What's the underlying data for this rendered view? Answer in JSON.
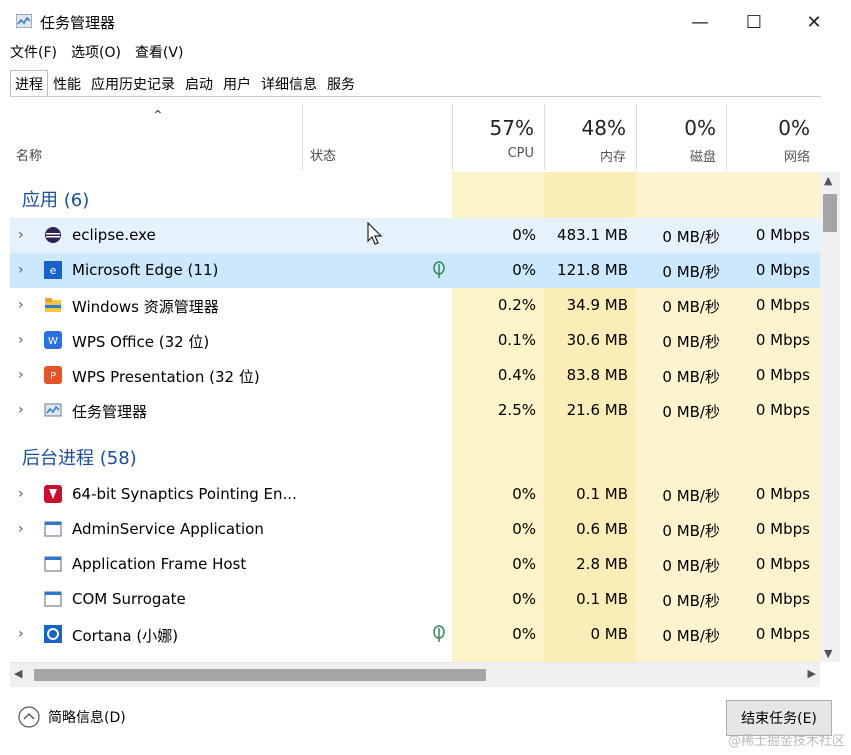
{
  "window": {
    "title": "任务管理器",
    "controls": {
      "minimize": "—",
      "maximize": "☐",
      "close": "✕"
    }
  },
  "menu": [
    "文件(F)",
    "选项(O)",
    "查看(V)"
  ],
  "tabs": [
    "进程",
    "性能",
    "应用历史记录",
    "启动",
    "用户",
    "详细信息",
    "服务"
  ],
  "columns": {
    "name": "名称",
    "status": "状态",
    "sort_indicator": "⌃",
    "cpu": {
      "pct": "57%",
      "label": "CPU"
    },
    "mem": {
      "pct": "48%",
      "label": "内存"
    },
    "disk": {
      "pct": "0%",
      "label": "磁盘"
    },
    "net": {
      "pct": "0%",
      "label": "网络"
    }
  },
  "groups": {
    "apps": "应用 (6)",
    "background": "后台进程 (58)"
  },
  "apps": [
    {
      "name": "eclipse.exe",
      "cpu": "0%",
      "mem": "483.1 MB",
      "disk": "0 MB/秒",
      "net": "0 Mbps",
      "icon": "eclipse-icon"
    },
    {
      "name": "Microsoft Edge (11)",
      "cpu": "0%",
      "mem": "121.8 MB",
      "disk": "0 MB/秒",
      "net": "0 Mbps",
      "icon": "edge-icon",
      "status": "leaf-icon"
    },
    {
      "name": "Windows 资源管理器",
      "cpu": "0.2%",
      "mem": "34.9 MB",
      "disk": "0 MB/秒",
      "net": "0 Mbps",
      "icon": "folder-icon"
    },
    {
      "name": "WPS Office (32 位)",
      "cpu": "0.1%",
      "mem": "30.6 MB",
      "disk": "0 MB/秒",
      "net": "0 Mbps",
      "icon": "wps-icon"
    },
    {
      "name": "WPS Presentation (32 位)",
      "cpu": "0.4%",
      "mem": "83.8 MB",
      "disk": "0 MB/秒",
      "net": "0 Mbps",
      "icon": "presentation-icon"
    },
    {
      "name": "任务管理器",
      "cpu": "2.5%",
      "mem": "21.6 MB",
      "disk": "0 MB/秒",
      "net": "0 Mbps",
      "icon": "taskmgr-icon"
    }
  ],
  "background": [
    {
      "name": "64-bit Synaptics Pointing En...",
      "cpu": "0%",
      "mem": "0.1 MB",
      "disk": "0 MB/秒",
      "net": "0 Mbps",
      "icon": "synaptics-icon"
    },
    {
      "name": "AdminService Application",
      "cpu": "0%",
      "mem": "0.6 MB",
      "disk": "0 MB/秒",
      "net": "0 Mbps",
      "icon": "app-icon"
    },
    {
      "name": "Application Frame Host",
      "cpu": "0%",
      "mem": "2.8 MB",
      "disk": "0 MB/秒",
      "net": "0 Mbps",
      "icon": "app-icon"
    },
    {
      "name": "COM Surrogate",
      "cpu": "0%",
      "mem": "0.1 MB",
      "disk": "0 MB/秒",
      "net": "0 Mbps",
      "icon": "app-icon"
    },
    {
      "name": "Cortana (小娜)",
      "cpu": "0%",
      "mem": "0 MB",
      "disk": "0 MB/秒",
      "net": "0 Mbps",
      "icon": "cortana-icon",
      "status": "leaf-icon"
    }
  ],
  "footer": {
    "summary": "简略信息(D)",
    "end_task": "结束任务(E)",
    "watermark": "@稀土掘金技术社区"
  },
  "colors": {
    "group": "#1b4d9b",
    "selected": "#cce8ff",
    "hover": "#e5f1fb",
    "heat_light": "#fdf6d8",
    "heat_mid": "#fbefbf",
    "heat_strong": "#f8e6a0"
  }
}
